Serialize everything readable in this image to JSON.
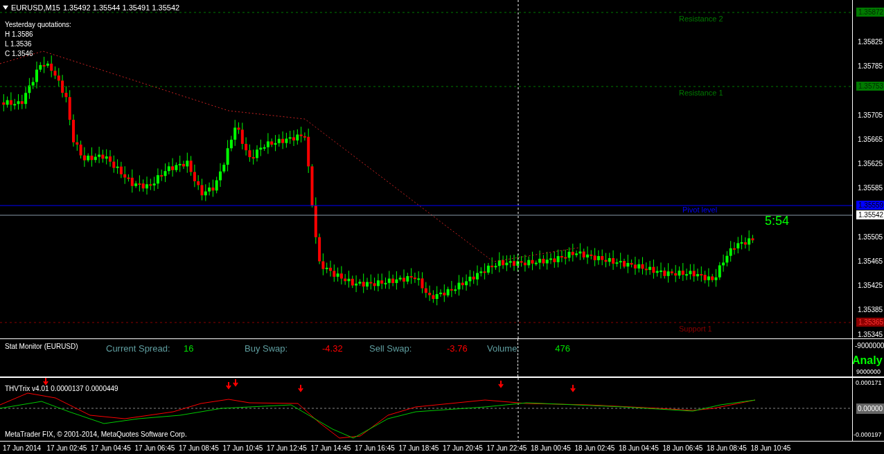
{
  "header": {
    "title": "EURUSD,M15",
    "quote": "1.35492 1.35544 1.35491 1.35542"
  },
  "yesterday": [
    "Yesterday quotations:",
    "H 1.3586",
    "L 1.3536",
    "C 1.3546"
  ],
  "levels": [
    {
      "kind": "dashed",
      "label": "Resistance 2",
      "price": "1.35872",
      "color": "#007a00"
    },
    {
      "kind": "dashed",
      "label": "Resistance 1",
      "price": "1.35753",
      "color": "#007a00"
    },
    {
      "kind": "solid",
      "label": "Pivot level",
      "price": "1.35559",
      "color": "#0000ff"
    },
    {
      "kind": "current",
      "price": "1.35542",
      "color": "#ffffff"
    },
    {
      "kind": "dashed",
      "label": "Support 1",
      "price": "1.35365",
      "color": "#8b0000"
    }
  ],
  "countdown": "5:54",
  "price_axis": [
    "1.35825",
    "1.35785",
    "1.35705",
    "1.35665",
    "1.35625",
    "1.35585",
    "1.35505",
    "1.35465",
    "1.35425",
    "1.35385",
    "1.35345"
  ],
  "stat_monitor": {
    "title": "Stat Monitor (EURUSD)",
    "items": [
      {
        "label": "Current Spread:",
        "value": "16",
        "color": "#00e000"
      },
      {
        "label": "Buy Swap:",
        "value": "-4.32",
        "color": "#ff0000"
      },
      {
        "label": "Sell Swap:",
        "value": "-3.76",
        "color": "#ff0000"
      },
      {
        "label": "Volume:",
        "value": "476",
        "color": "#00e000"
      }
    ],
    "axis": [
      "-9000000",
      "9000000"
    ],
    "overlay": "Analy"
  },
  "indicator": {
    "title": "THVTrix v4.01 0.0000137 0.0000449",
    "axis": [
      "0.000171",
      "0.00000",
      "-0.000197"
    ],
    "copyright": "MetaTrader FIX, © 2001-2014, MetaQuotes Software Corp."
  },
  "time_axis": [
    "17 Jun 2014",
    "17 Jun 02:45",
    "17 Jun 04:45",
    "17 Jun 06:45",
    "17 Jun 08:45",
    "17 Jun 10:45",
    "17 Jun 12:45",
    "17 Jun 14:45",
    "17 Jun 16:45",
    "17 Jun 18:45",
    "17 Jun 20:45",
    "17 Jun 22:45",
    "18 Jun 00:45",
    "18 Jun 02:45",
    "18 Jun 04:45",
    "18 Jun 06:45",
    "18 Jun 08:45",
    "18 Jun 10:45"
  ]
}
